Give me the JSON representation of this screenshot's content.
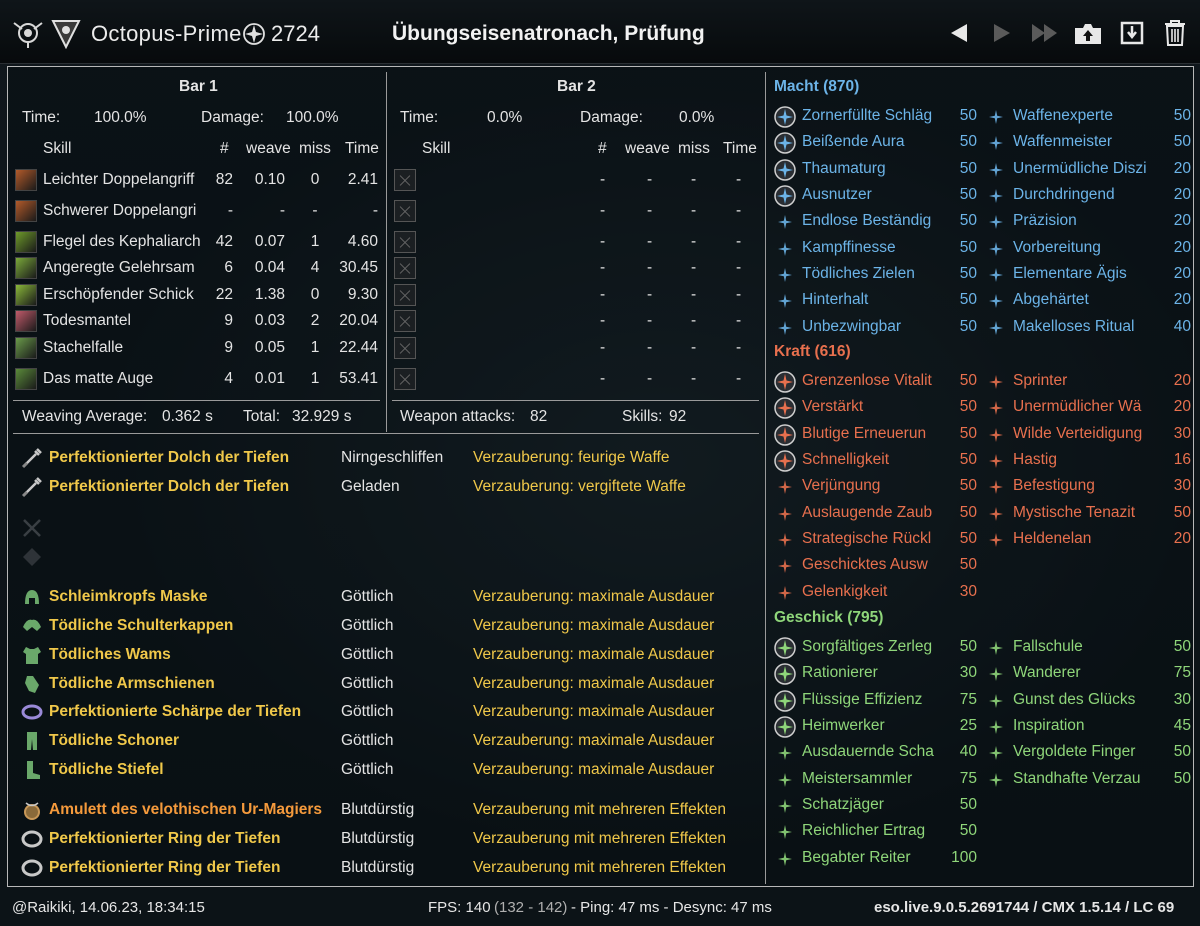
{
  "header": {
    "player_name": "Octopus-Prime",
    "champion_points": "2724",
    "fight_title": "Übungseisenatronach, Prüfung"
  },
  "bar1": {
    "title": "Bar 1",
    "time_label": "Time:",
    "time_value": "100.0%",
    "damage_label": "Damage:",
    "damage_value": "100.0%",
    "col_skill": "Skill",
    "col_count": "#",
    "col_weave": "weave",
    "col_miss": "miss",
    "col_time": "Time",
    "rows": [
      {
        "name": "Leichter Doppelangriff",
        "count": "82",
        "weave": "0.10",
        "miss": "0",
        "time": "2.41",
        "color": "#b25a2a"
      },
      {
        "name": "Schwerer Doppelangri",
        "count": "-",
        "weave": "-",
        "miss": "-",
        "time": "-",
        "color": "#b25a2a"
      },
      {
        "name": "Flegel des Kephaliarch",
        "count": "42",
        "weave": "0.07",
        "miss": "1",
        "time": "4.60",
        "color": "#6e9a2a"
      },
      {
        "name": "Angeregte Gelehrsam",
        "count": "6",
        "weave": "0.04",
        "miss": "4",
        "time": "30.45",
        "color": "#7aa83a"
      },
      {
        "name": "Erschöpfender Schick",
        "count": "22",
        "weave": "1.38",
        "miss": "0",
        "time": "9.30",
        "color": "#8ab83a"
      },
      {
        "name": "Todesmantel",
        "count": "9",
        "weave": "0.03",
        "miss": "2",
        "time": "20.04",
        "color": "#c05a6a"
      },
      {
        "name": "Stachelfalle",
        "count": "9",
        "weave": "0.05",
        "miss": "1",
        "time": "22.44",
        "color": "#6a9a4a"
      },
      {
        "name": "Das matte Auge",
        "count": "4",
        "weave": "0.01",
        "miss": "1",
        "time": "53.41",
        "color": "#5a8a3a"
      }
    ],
    "weaving_label": "Weaving Average:",
    "weaving_value": "0.362 s",
    "total_label": "Total:",
    "total_value": "32.929 s"
  },
  "bar2": {
    "title": "Bar 2",
    "time_label": "Time:",
    "time_value": "0.0%",
    "damage_label": "Damage:",
    "damage_value": "0.0%",
    "col_skill": "Skill",
    "col_count": "#",
    "col_weave": "weave",
    "col_miss": "miss",
    "col_time": "Time",
    "dash": "-",
    "weapon_label": "Weapon attacks:",
    "weapon_value": "82",
    "skills_label": "Skills:",
    "skills_value": "92"
  },
  "gear": {
    "weapons": [
      {
        "name": "Perfektionierter Dolch der Tiefen",
        "trait": "Nirngeschliffen",
        "ench": "Verzauberung: feurige Waffe",
        "icon": "dagger-icon"
      },
      {
        "name": "Perfektionierter Dolch der Tiefen",
        "trait": "Geladen",
        "ench": "Verzauberung: vergiftete Waffe",
        "icon": "dagger-icon"
      }
    ],
    "armor": [
      {
        "name": "Schleimkropfs Maske",
        "trait": "Göttlich",
        "ench": "Verzauberung: maximale Ausdauer",
        "icon": "helmet-icon"
      },
      {
        "name": "Tödliche Schulterkappen",
        "trait": "Göttlich",
        "ench": "Verzauberung: maximale Ausdauer",
        "icon": "shoulder-icon"
      },
      {
        "name": "Tödliches Wams",
        "trait": "Göttlich",
        "ench": "Verzauberung: maximale Ausdauer",
        "icon": "chest-icon"
      },
      {
        "name": "Tödliche Armschienen",
        "trait": "Göttlich",
        "ench": "Verzauberung: maximale Ausdauer",
        "icon": "gloves-icon"
      },
      {
        "name": "Perfektionierte Schärpe der Tiefen",
        "trait": "Göttlich",
        "ench": "Verzauberung: maximale Ausdauer",
        "icon": "belt-icon"
      },
      {
        "name": "Tödliche Schoner",
        "trait": "Göttlich",
        "ench": "Verzauberung: maximale Ausdauer",
        "icon": "legs-icon"
      },
      {
        "name": "Tödliche Stiefel",
        "trait": "Göttlich",
        "ench": "Verzauberung: maximale Ausdauer",
        "icon": "boots-icon"
      }
    ],
    "jewelry": [
      {
        "name": "Amulett des velothischen Ur-Magiers",
        "trait": "Blutdürstig",
        "ench": "Verzauberung mit mehreren Effekten",
        "icon": "amulet-icon",
        "orange": true
      },
      {
        "name": "Perfektionierter Ring der Tiefen",
        "trait": "Blutdürstig",
        "ench": "Verzauberung mit mehreren Effekten",
        "icon": "ring-icon"
      },
      {
        "name": "Perfektionierter Ring der Tiefen",
        "trait": "Blutdürstig",
        "ench": "Verzauberung mit mehreren Effekten",
        "icon": "ring-icon"
      }
    ]
  },
  "cp": {
    "macht": {
      "title": "Macht (870)",
      "left": [
        {
          "name": "Zornerfüllte Schläg",
          "val": "50",
          "slotted": true
        },
        {
          "name": "Beißende Aura",
          "val": "50",
          "slotted": true
        },
        {
          "name": "Thaumaturg",
          "val": "50",
          "slotted": true
        },
        {
          "name": "Ausnutzer",
          "val": "50",
          "slotted": true
        },
        {
          "name": "Endlose Beständig",
          "val": "50"
        },
        {
          "name": "Kampffinesse",
          "val": "50"
        },
        {
          "name": "Tödliches Zielen",
          "val": "50"
        },
        {
          "name": "Hinterhalt",
          "val": "50"
        },
        {
          "name": "Unbezwingbar",
          "val": "50"
        }
      ],
      "right": [
        {
          "name": "Waffenexperte",
          "val": "50"
        },
        {
          "name": "Waffenmeister",
          "val": "50"
        },
        {
          "name": "Unermüdliche Diszi",
          "val": "20"
        },
        {
          "name": "Durchdringend",
          "val": "20"
        },
        {
          "name": "Präzision",
          "val": "20"
        },
        {
          "name": "Vorbereitung",
          "val": "20"
        },
        {
          "name": "Elementare Ägis",
          "val": "20"
        },
        {
          "name": "Abgehärtet",
          "val": "20"
        },
        {
          "name": "Makelloses Ritual",
          "val": "40"
        }
      ]
    },
    "kraft": {
      "title": "Kraft (616)",
      "left": [
        {
          "name": "Grenzenlose Vitalit",
          "val": "50",
          "slotted": true
        },
        {
          "name": "Verstärkt",
          "val": "50",
          "slotted": true
        },
        {
          "name": "Blutige Erneuerun",
          "val": "50",
          "slotted": true
        },
        {
          "name": "Schnelligkeit",
          "val": "50",
          "slotted": true
        },
        {
          "name": "Verjüngung",
          "val": "50"
        },
        {
          "name": "Auslaugende Zaub",
          "val": "50"
        },
        {
          "name": "Strategische Rückl",
          "val": "50"
        },
        {
          "name": "Geschicktes Ausw",
          "val": "50"
        },
        {
          "name": "Gelenkigkeit",
          "val": "30"
        }
      ],
      "right": [
        {
          "name": "Sprinter",
          "val": "20"
        },
        {
          "name": "Unermüdlicher Wä",
          "val": "20"
        },
        {
          "name": "Wilde Verteidigung",
          "val": "30"
        },
        {
          "name": "Hastig",
          "val": "16"
        },
        {
          "name": "Befestigung",
          "val": "30"
        },
        {
          "name": "Mystische Tenazit",
          "val": "50"
        },
        {
          "name": "Heldenelan",
          "val": "20"
        }
      ]
    },
    "geschick": {
      "title": "Geschick (795)",
      "left": [
        {
          "name": "Sorgfältiges Zerleg",
          "val": "50",
          "slotted": true
        },
        {
          "name": "Rationierer",
          "val": "30",
          "slotted": true
        },
        {
          "name": "Flüssige Effizienz",
          "val": "75",
          "slotted": true
        },
        {
          "name": "Heimwerker",
          "val": "25",
          "slotted": true
        },
        {
          "name": "Ausdauernde Scha",
          "val": "40"
        },
        {
          "name": "Meistersammler",
          "val": "75"
        },
        {
          "name": "Schatzjäger",
          "val": "50"
        },
        {
          "name": "Reichlicher Ertrag",
          "val": "50"
        },
        {
          "name": "Begabter Reiter",
          "val": "100"
        }
      ],
      "right": [
        {
          "name": "Fallschule",
          "val": "50"
        },
        {
          "name": "Wanderer",
          "val": "75"
        },
        {
          "name": "Gunst des Glücks",
          "val": "30"
        },
        {
          "name": "Inspiration",
          "val": "45"
        },
        {
          "name": "Vergoldete Finger",
          "val": "50"
        },
        {
          "name": "Standhafte Verzau",
          "val": "50"
        }
      ]
    }
  },
  "footer": {
    "author": "@Raikiki, 14.06.23, 18:34:15",
    "fps": "FPS: 140",
    "fps_range": "(132 - 142)",
    "ping": "- Ping: 47 ms - Desync: 47 ms",
    "version": "eso.live.9.0.5.2691744 / CMX 1.5.14 / LC 69"
  },
  "colors": {
    "macht": "#6cb4e8",
    "kraft": "#e8704e",
    "geschick": "#8fd67a",
    "gear_gold": "#f0c84a",
    "gear_orange": "#f59a3c"
  }
}
